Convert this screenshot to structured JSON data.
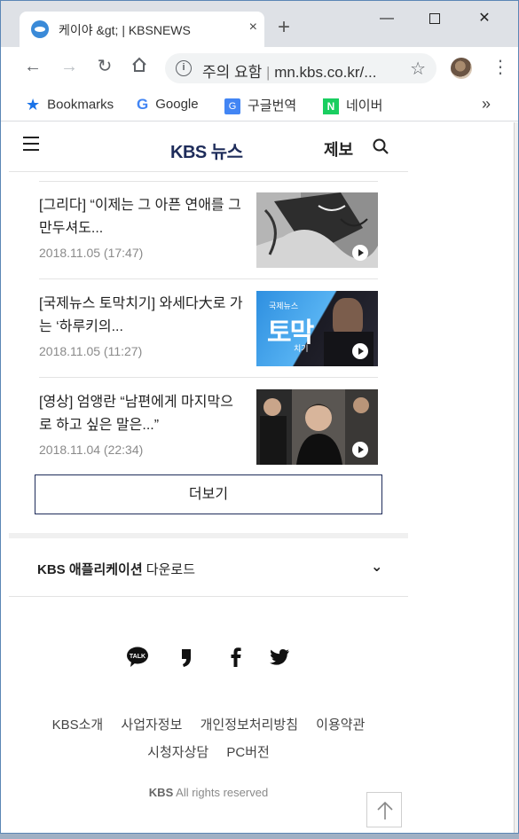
{
  "browser": {
    "tab_title": "케이야 &gt; | KBSNEWS",
    "tab_close": "×",
    "new_tab": "+",
    "window_min": "—",
    "window_close": "✕",
    "address_security": "주의 요함",
    "address_separator": "|",
    "address_url": "mn.kbs.co.kr/...",
    "bookmarks": [
      {
        "label": "Bookmarks",
        "icon": "star-icon"
      },
      {
        "label": "Google",
        "icon": "google-icon"
      },
      {
        "label": "구글번역",
        "icon": "google-translate-icon"
      },
      {
        "label": "네이버",
        "icon": "naver-icon"
      }
    ],
    "bookmarks_more": "»"
  },
  "site": {
    "logo": "KBS 뉴스",
    "report_label": "제보",
    "news": [
      {
        "title": "[그리다] “이제는 그 아픈 연애를 그만두셔도...",
        "date": "2018.11.05 (17:47)"
      },
      {
        "title": "[국제뉴스 토막치기] 와세다大로 가는 ‘하루키의...",
        "date": "2018.11.05 (11:27)"
      },
      {
        "title": "[영상] 엄앵란 “남편에게 마지막으로 하고 싶은 말은...”",
        "date": "2018.11.04 (22:34)"
      }
    ],
    "thumb2_badge": "국제뉴스",
    "thumb2_big": "토막",
    "thumb2_small": "치기",
    "more_button": "더보기",
    "app_download_brand": "KBS 애플리케이션",
    "app_download_rest": " 다운로드",
    "footer_links_row1": [
      "KBS소개",
      "사업자정보",
      "개인정보처리방침",
      "이용약관"
    ],
    "footer_links_row2": [
      "시청자상담",
      "PC버전"
    ],
    "copyright_brand": "KBS",
    "copyright_text": " All rights reserved",
    "talk_label": "TALK"
  },
  "colors": {
    "brand_navy": "#1e2c5a",
    "accent_blue": "#1a73e8",
    "naver_green": "#19ce60"
  }
}
